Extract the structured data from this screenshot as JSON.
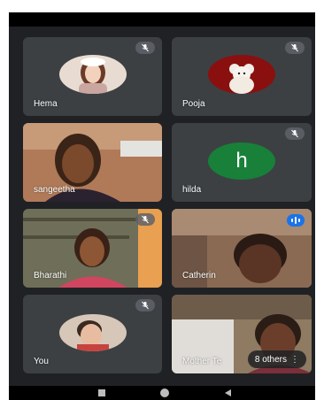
{
  "participants": [
    {
      "name": "Hema",
      "muted": true,
      "type": "avatar-photo"
    },
    {
      "name": "Pooja",
      "muted": true,
      "type": "avatar-photo"
    },
    {
      "name": "sangeetha",
      "muted": false,
      "type": "video"
    },
    {
      "name": "hilda",
      "muted": true,
      "type": "initial",
      "initial": "h",
      "color": "#188038"
    },
    {
      "name": "Bharathi",
      "muted": true,
      "type": "video"
    },
    {
      "name": "Catherin",
      "muted": false,
      "type": "video",
      "speaking": true
    },
    {
      "name": "You",
      "muted": true,
      "type": "avatar-photo"
    },
    {
      "name": "Mother Te",
      "muted": false,
      "type": "video"
    }
  ],
  "others_count_label": "8 others",
  "others_more": "⋮",
  "colors": {
    "background": "#202124",
    "tile": "#3c4043",
    "accent": "#1a73e8"
  },
  "icons": {
    "mute": "mic-off-icon",
    "speaking": "audio-level-icon"
  }
}
